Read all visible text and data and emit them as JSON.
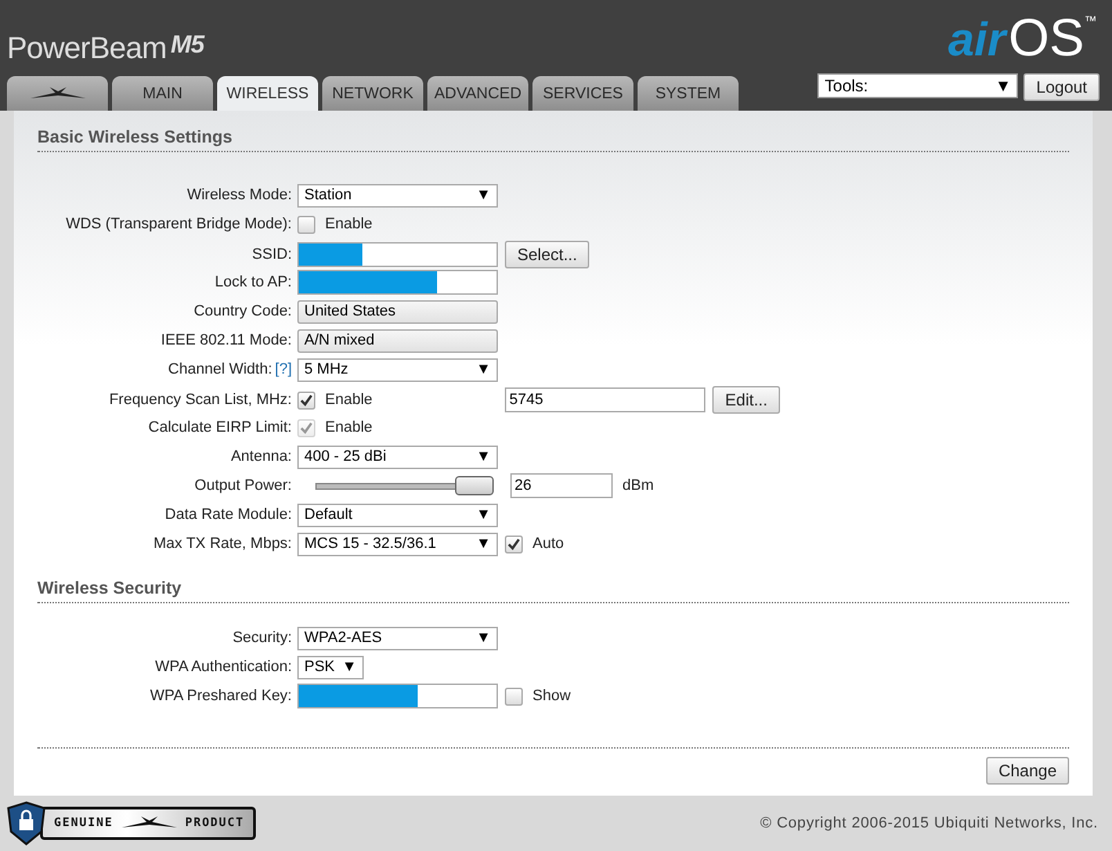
{
  "header": {
    "product": "PowerBeam",
    "model": "M5",
    "brand_air": "air",
    "brand_os": "OS",
    "trademark": "™"
  },
  "tabs": [
    {
      "kind": "logo",
      "selected": false
    },
    {
      "label": "MAIN",
      "selected": false
    },
    {
      "label": "WIRELESS",
      "selected": true
    },
    {
      "label": "NETWORK",
      "selected": false
    },
    {
      "label": "ADVANCED",
      "selected": false
    },
    {
      "label": "SERVICES",
      "selected": false
    },
    {
      "label": "SYSTEM",
      "selected": false
    }
  ],
  "tools": {
    "value": "Tools:",
    "arrow": "▼"
  },
  "logout": "Logout",
  "sections": [
    {
      "title": "Basic Wireless Settings",
      "rows": [
        {
          "kind": "select",
          "label": "Wireless Mode:",
          "value": "Station",
          "arrow": "▼"
        },
        {
          "kind": "checkbox",
          "label": "WDS (Transparent Bridge Mode):",
          "checked": false,
          "disabled": false,
          "option": "Enable"
        },
        {
          "kind": "masked",
          "label": "SSID:",
          "button": "Select..."
        },
        {
          "kind": "masked",
          "label": "Lock to AP:"
        },
        {
          "kind": "readonly",
          "label": "Country Code:",
          "value": "United States"
        },
        {
          "kind": "readonly",
          "label": "IEEE 802.11 Mode:",
          "value": "A/N mixed"
        },
        {
          "kind": "select",
          "label": "Channel Width:",
          "help": "[?]",
          "value": "5 MHz",
          "arrow": "▼"
        },
        {
          "kind": "checkbox",
          "label": "Frequency Scan List, MHz:",
          "checked": true,
          "disabled": false,
          "option": "Enable",
          "value": "5745",
          "button": "Edit..."
        },
        {
          "kind": "checkbox",
          "label": "Calculate EIRP Limit:",
          "checked": true,
          "disabled": true,
          "option": "Enable"
        },
        {
          "kind": "select",
          "label": "Antenna:",
          "value": "400 - 25 dBi",
          "arrow": "▼"
        },
        {
          "kind": "slider",
          "label": "Output Power:",
          "level": 1,
          "value": "26",
          "unit": "dBm"
        },
        {
          "kind": "select",
          "label": "Data Rate Module:",
          "value": "Default",
          "arrow": "▼"
        },
        {
          "kind": "select",
          "label": "Max TX Rate, Mbps:",
          "value": "MCS 15 - 32.5/36.1",
          "arrow": "▼",
          "checked": true,
          "option": "Auto"
        }
      ]
    },
    {
      "title": "Wireless Security",
      "rows": [
        {
          "kind": "select",
          "label": "Security:",
          "value": "WPA2-AES",
          "arrow": "▼"
        },
        {
          "kind": "smallselect",
          "label": "WPA Authentication:",
          "value": "PSK",
          "arrow": "▼"
        },
        {
          "kind": "masked",
          "label": "WPA Preshared Key:",
          "checked": false,
          "option": "Show"
        }
      ]
    }
  ],
  "change": "Change",
  "badge": {
    "left": "GENUINE",
    "right": "PRODUCT"
  },
  "copyright": "© Copyright 2006-2015 Ubiquiti Networks, Inc."
}
